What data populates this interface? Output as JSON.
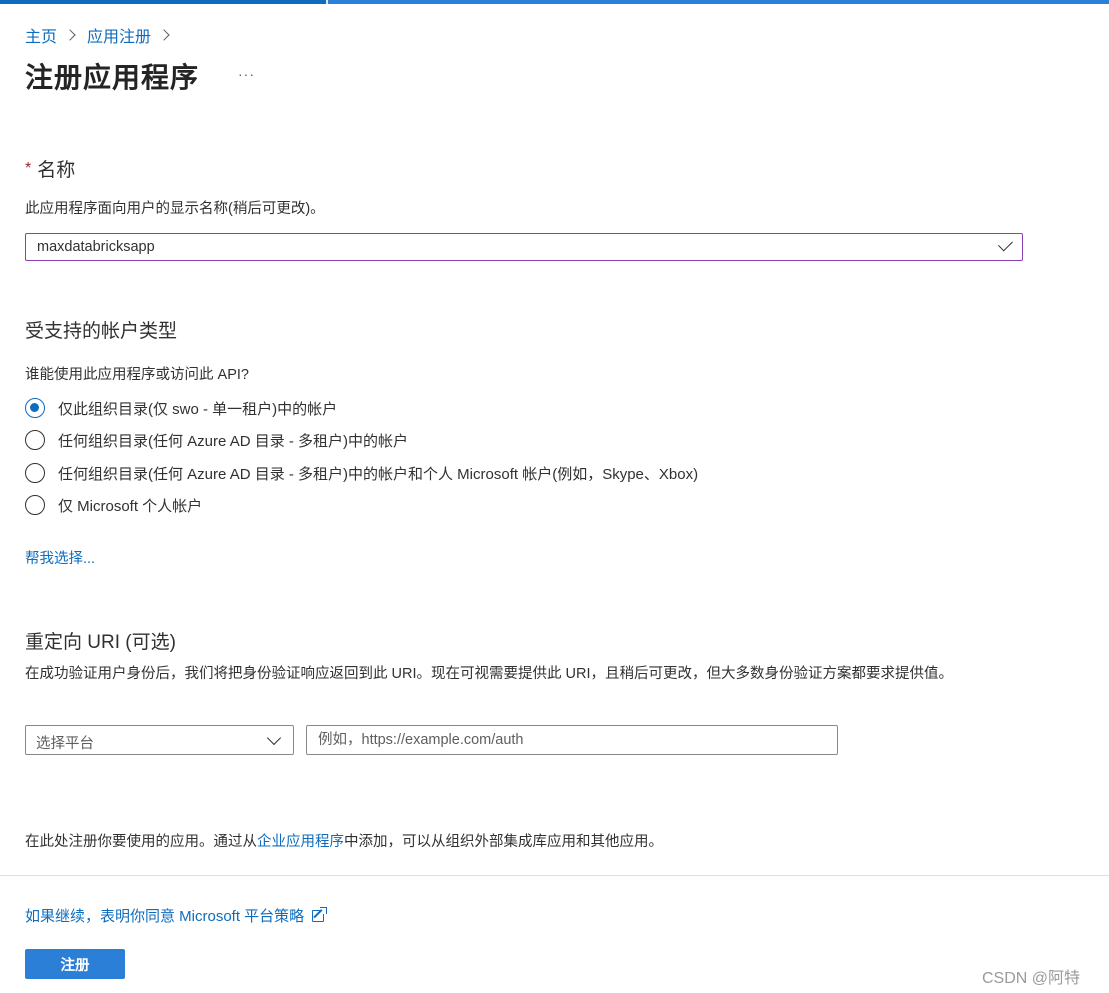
{
  "breadcrumb": {
    "home": "主页",
    "app_registrations": "应用注册"
  },
  "page": {
    "title": "注册应用程序",
    "more": "···"
  },
  "name_section": {
    "required_mark": "*",
    "title": "名称",
    "description": "此应用程序面向用户的显示名称(稍后可更改)。",
    "value": "maxdatabricksapp"
  },
  "account_types": {
    "title": "受支持的帐户类型",
    "question": "谁能使用此应用程序或访问此 API?",
    "options": [
      {
        "label": "仅此组织目录(仅 swo - 单一租户)中的帐户",
        "selected": true
      },
      {
        "label": "任何组织目录(任何 Azure AD 目录 - 多租户)中的帐户",
        "selected": false
      },
      {
        "label": "任何组织目录(任何 Azure AD 目录 - 多租户)中的帐户和个人 Microsoft 帐户(例如，Skype、Xbox)",
        "selected": false
      },
      {
        "label": "仅 Microsoft 个人帐户",
        "selected": false
      }
    ],
    "help_link": "帮我选择..."
  },
  "redirect_uri": {
    "title": "重定向 URI (可选)",
    "description": "在成功验证用户身份后，我们将把身份验证响应返回到此 URI。现在可视需要提供此 URI，且稍后可更改，但大多数身份验证方案都要求提供值。",
    "platform_placeholder": "选择平台",
    "uri_placeholder": "例如，https://example.com/auth"
  },
  "bottom_note": {
    "before": "在此处注册你要使用的应用。通过从",
    "link": "企业应用程序",
    "after": "中添加，可以从组织外部集成库应用和其他应用。"
  },
  "policy_link": "如果继续，表明你同意 Microsoft 平台策略",
  "register_button": "注册",
  "watermark": "CSDN @阿特",
  "colors": {
    "accent": "#0f6cbd",
    "button": "#2b7fd6",
    "input_focus_border": "#8a3fb3",
    "required": "#a4262c"
  }
}
